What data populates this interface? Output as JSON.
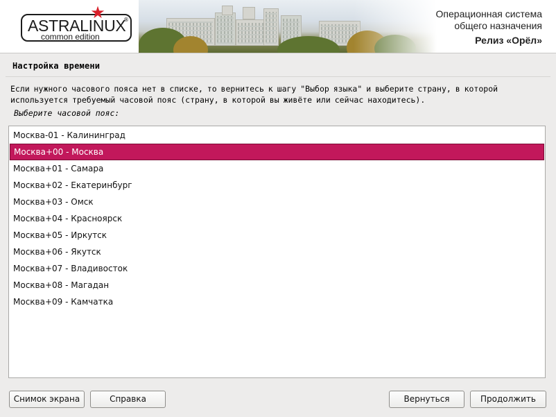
{
  "header": {
    "logo_title": "ASTRALINUX",
    "logo_registered": "®",
    "logo_subtitle": "common edition",
    "os_line1": "Операционная система",
    "os_line2": "общего назначения",
    "release": "Релиз «Орёл»"
  },
  "page": {
    "title": "Настройка времени",
    "description": "Если нужного часового пояса нет в списке, то вернитесь к шагу \"Выбор языка\" и выберите страну, в которой используется требуемый часовой пояс (страну, в которой вы живёте или сейчас находитесь).",
    "prompt": "Выберите часовой пояс:"
  },
  "timezones": {
    "items": [
      "Москва-01 - Калининград",
      "Москва+00 - Москва",
      "Москва+01 - Самара",
      "Москва+02 - Екатеринбург",
      "Москва+03 - Омск",
      "Москва+04 - Красноярск",
      "Москва+05 - Иркутск",
      "Москва+06 - Якутск",
      "Москва+07 - Владивосток",
      "Москва+08 - Магадан",
      "Москва+09 - Камчатка"
    ],
    "selected": "Москва+00 - Москва"
  },
  "buttons": {
    "screenshot": "Снимок экрана",
    "help": "Справка",
    "back": "Вернуться",
    "continue": "Продолжить"
  },
  "colors": {
    "selection": "#c2185b",
    "star": "#d8202a"
  }
}
